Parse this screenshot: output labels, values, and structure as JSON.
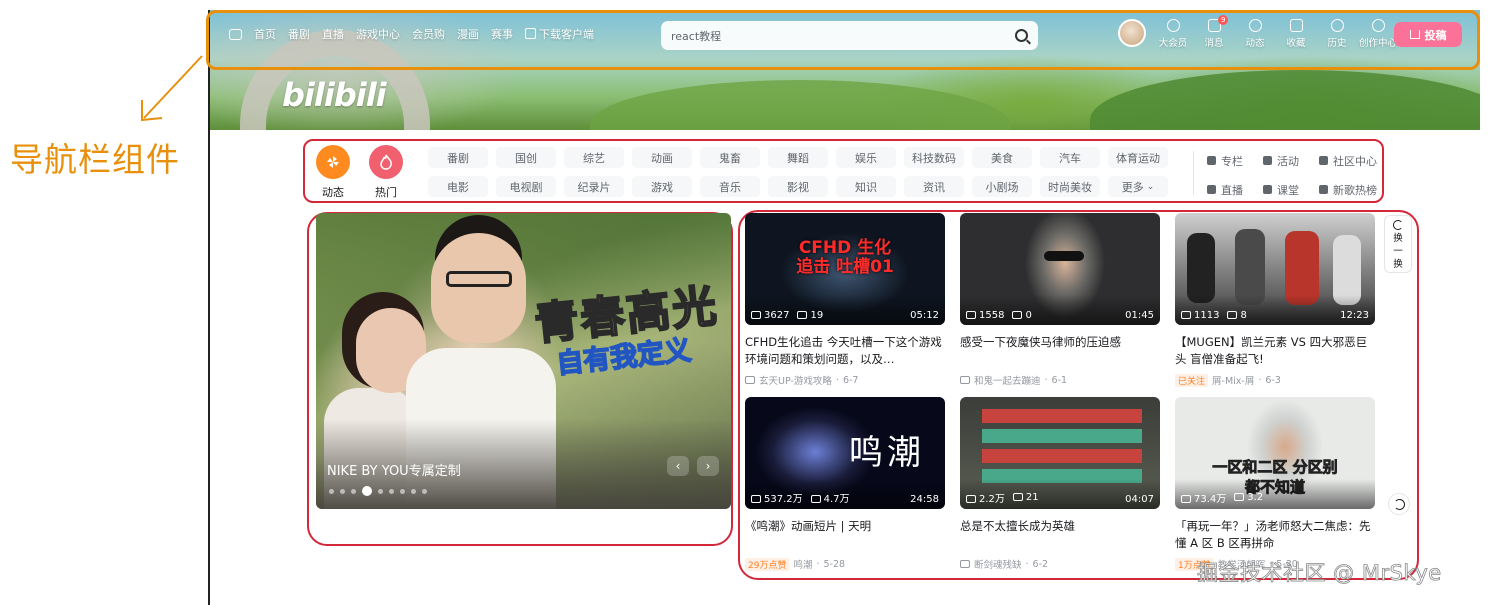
{
  "annotation": {
    "label": "导航栏组件"
  },
  "header": {
    "logo_text": "bilibili",
    "nav_left": [
      "首页",
      "番剧",
      "直播",
      "游戏中心",
      "会员购",
      "漫画",
      "赛事",
      "下载客户端"
    ],
    "search": {
      "value": "react教程",
      "placeholder": "react教程"
    },
    "right_nav": [
      {
        "label": "大会员",
        "icon": "vip-icon"
      },
      {
        "label": "消息",
        "icon": "message-icon",
        "badge": "9"
      },
      {
        "label": "动态",
        "icon": "dynamic-icon"
      },
      {
        "label": "收藏",
        "icon": "favorite-icon"
      },
      {
        "label": "历史",
        "icon": "history-icon"
      },
      {
        "label": "创作中心",
        "icon": "creator-icon"
      }
    ],
    "upload_label": "投稿"
  },
  "channels": {
    "dynamic_label": "动态",
    "hot_label": "热门",
    "categories": [
      "番剧",
      "国创",
      "综艺",
      "动画",
      "鬼畜",
      "舞蹈",
      "娱乐",
      "科技数码",
      "美食",
      "汽车",
      "体育运动",
      "电影",
      "电视剧",
      "纪录片",
      "游戏",
      "音乐",
      "影视",
      "知识",
      "资讯",
      "小剧场",
      "时尚美妆",
      "更多"
    ],
    "more_arrow": "⌄",
    "side_links": [
      "专栏",
      "活动",
      "社区中心",
      "直播",
      "课堂",
      "新歌热榜"
    ]
  },
  "carousel": {
    "title_big": "青春高光",
    "title_sub": "自有我定义",
    "caption": "NIKE BY YOU专属定制",
    "prev": "‹",
    "next": "›",
    "dot_count": 9,
    "active_dot": 3
  },
  "videos": [
    {
      "title": "CFHD生化追击 今天吐槽一下这个游戏环境问题和策划问题，以及…",
      "plays": "3627",
      "danmaku": "19",
      "duration": "05:12",
      "author": "玄天UP-游戏攻略",
      "date": "6-7",
      "tag": "",
      "cover_text": "CFHD 生化追击 吐槽01"
    },
    {
      "title": "感受一下夜魔侠马律师的压迫感",
      "plays": "1558",
      "danmaku": "0",
      "duration": "01:45",
      "author": "和鬼一起去蹦迪",
      "date": "6-1",
      "tag": "",
      "cover_text": ""
    },
    {
      "title": "【MUGEN】凯兰元素 VS 四大邪恶巨头 盲僧准备起飞!",
      "plays": "1113",
      "danmaku": "8",
      "duration": "12:23",
      "author": "屑-Mix-屑",
      "date": "6-3",
      "tag": "已关注",
      "cover_text": ""
    },
    {
      "title": "《鸣潮》动画短片 | 天明",
      "plays": "537.2万",
      "danmaku": "4.7万",
      "duration": "24:58",
      "author": "鸣潮",
      "date": "5-28",
      "tag": "29万点赞",
      "cover_text": "鸣潮"
    },
    {
      "title": "总是不太擅长成为英雄",
      "plays": "2.2万",
      "danmaku": "21",
      "duration": "04:07",
      "author": "断剑魂残缺",
      "date": "6-2",
      "tag": "",
      "cover_text": ""
    },
    {
      "title": "「再玩一年？」汤老师怒大二焦虑：先懂 A 区 B 区再拼命",
      "plays": "73.4万",
      "danmaku": "3.2",
      "duration": "",
      "author": "教学汤朝晖",
      "date": "5-30",
      "tag": "1万点赞",
      "cover_text": "一区和二区 分区别都不知道"
    }
  ],
  "refresh": {
    "label_lines": [
      "换",
      "一",
      "换"
    ]
  },
  "watermark": "掘金技术社区 @ MrSkye",
  "colors": {
    "accent_pink": "#fb7299",
    "annotation_orange": "#e8900c",
    "frame_red": "#d3283a",
    "dynamic_orange": "#ff8a1f",
    "hot_red": "#f0606f"
  }
}
